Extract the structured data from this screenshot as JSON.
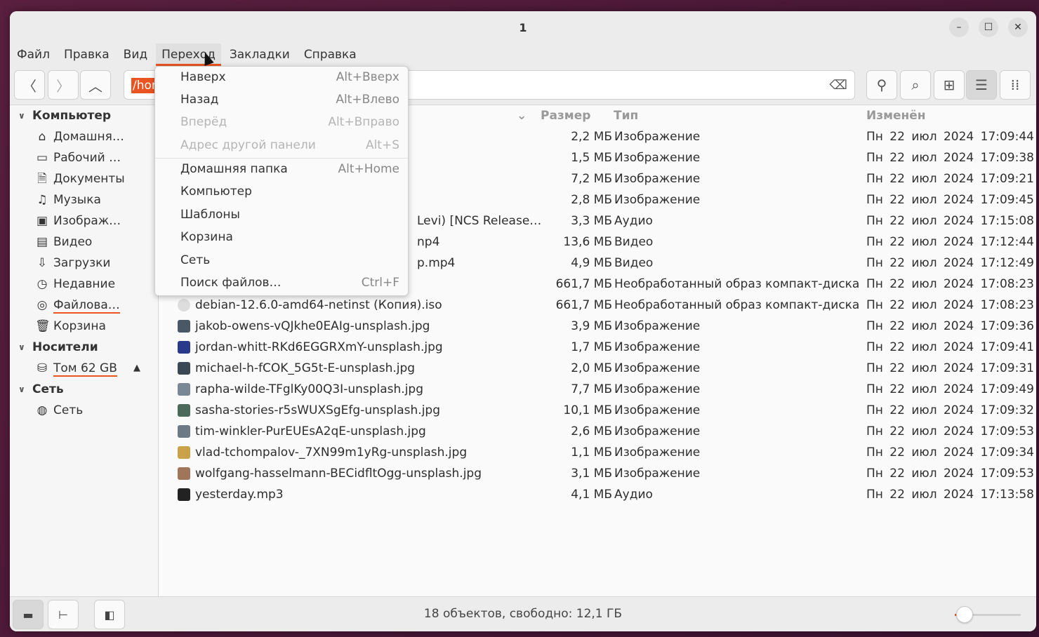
{
  "window": {
    "title": "1",
    "controls": {
      "minimize": "–",
      "maximize": "☐",
      "close": "✕"
    }
  },
  "menubar": [
    "Файл",
    "Правка",
    "Вид",
    "Переход",
    "Закладки",
    "Справка"
  ],
  "toolbar": {
    "path_selected": "/home",
    "icons": [
      "back-icon",
      "forward-icon",
      "up-icon",
      "location-icon",
      "search-icon",
      "grid-view-icon",
      "list-view-icon",
      "compact-view-icon"
    ]
  },
  "sidebar": {
    "computer_header": "Компьютер",
    "computer_items": [
      {
        "label": "Домашня…",
        "icon": "⌂"
      },
      {
        "label": "Рабочий …",
        "icon": "▭"
      },
      {
        "label": "Документы",
        "icon": "🗎"
      },
      {
        "label": "Музыка",
        "icon": "♫"
      },
      {
        "label": "Изображ…",
        "icon": "▣"
      },
      {
        "label": "Видео",
        "icon": "▤"
      },
      {
        "label": "Загрузки",
        "icon": "⇩"
      },
      {
        "label": "Недавние",
        "icon": "◷"
      },
      {
        "label": "Файлова…",
        "icon": "◎"
      },
      {
        "label": "Корзина",
        "icon": "🗑"
      }
    ],
    "devices_header": "Носители",
    "device_item": {
      "label": "Том 62 GB",
      "icon": "⛁",
      "eject": "▲"
    },
    "network_header": "Сеть",
    "network_item": {
      "label": "Сеть",
      "icon": "◍"
    }
  },
  "columns": {
    "size": "Размер",
    "type": "Тип",
    "modified": "Изменён"
  },
  "files": [
    {
      "name": "",
      "size": "2,2 МБ",
      "type": "Изображение",
      "date": "Пн 22 июл 2024 17:09:44"
    },
    {
      "name": "",
      "size": "1,5 МБ",
      "type": "Изображение",
      "date": "Пн 22 июл 2024 17:09:38"
    },
    {
      "name": "",
      "size": "7,2 МБ",
      "type": "Изображение",
      "date": "Пн 22 июл 2024 17:09:21"
    },
    {
      "name": "",
      "size": "2,8 МБ",
      "type": "Изображение",
      "date": "Пн 22 июл 2024 17:09:45"
    },
    {
      "name": "Levi) [NCS Release…",
      "size": "3,3 МБ",
      "type": "Аудио",
      "date": "Пн 22 июл 2024 17:15:08"
    },
    {
      "name": "np4",
      "size": "13,6 МБ",
      "type": "Видео",
      "date": "Пн 22 июл 2024 17:12:44"
    },
    {
      "name": "p.mp4",
      "size": "4,9 МБ",
      "type": "Видео",
      "date": "Пн 22 июл 2024 17:12:49"
    },
    {
      "name": "",
      "size": "661,7 МБ",
      "type": "Необработанный образ компакт-диска",
      "date": "Пн 22 июл 2024 17:08:23"
    },
    {
      "name": "debian-12.6.0-amd64-netinst (Копия).iso",
      "size": "661,7 МБ",
      "type": "Необработанный образ компакт-диска",
      "date": "Пн 22 июл 2024 17:08:23"
    },
    {
      "name": "jakob-owens-vQJkhe0EAIg-unsplash.jpg",
      "size": "3,9 МБ",
      "type": "Изображение",
      "date": "Пн 22 июл 2024 17:09:36"
    },
    {
      "name": "jordan-whitt-RKd6EGGRXmY-unsplash.jpg",
      "size": "1,7 МБ",
      "type": "Изображение",
      "date": "Пн 22 июл 2024 17:09:41"
    },
    {
      "name": "michael-h-fCOK_5G5t-E-unsplash.jpg",
      "size": "2,0 МБ",
      "type": "Изображение",
      "date": "Пн 22 июл 2024 17:09:31"
    },
    {
      "name": "rapha-wilde-TFglKy00Q3I-unsplash.jpg",
      "size": "7,7 МБ",
      "type": "Изображение",
      "date": "Пн 22 июл 2024 17:09:49"
    },
    {
      "name": "sasha-stories-r5sWUXSgEfg-unsplash.jpg",
      "size": "10,1 МБ",
      "type": "Изображение",
      "date": "Пн 22 июл 2024 17:09:32"
    },
    {
      "name": "tim-winkler-PurEUEsA2qE-unsplash.jpg",
      "size": "2,6 МБ",
      "type": "Изображение",
      "date": "Пн 22 июл 2024 17:09:53"
    },
    {
      "name": "vlad-tchompalov-_7XN99m1yRg-unsplash.jpg",
      "size": "1,1 МБ",
      "type": "Изображение",
      "date": "Пн 22 июл 2024 17:09:34"
    },
    {
      "name": "wolfgang-hasselmann-BECidfltOgg-unsplash.jpg",
      "size": "3,1 МБ",
      "type": "Изображение",
      "date": "Пн 22 июл 2024 17:09:53"
    },
    {
      "name": "yesterday.mp3",
      "size": "4,1 МБ",
      "type": "Аудио",
      "date": "Пн 22 июл 2024 17:13:58"
    }
  ],
  "go_menu": [
    {
      "label": "Наверх",
      "shortcut": "Alt+Вверх",
      "disabled": false
    },
    {
      "label": "Назад",
      "shortcut": "Alt+Влево",
      "disabled": false
    },
    {
      "label": "Вперёд",
      "shortcut": "Alt+Вправо",
      "disabled": true
    },
    {
      "label": "Адрес другой панели",
      "shortcut": "Alt+S",
      "disabled": true
    },
    {
      "label": "Домашняя папка",
      "shortcut": "Alt+Home",
      "disabled": false
    },
    {
      "label": "Компьютер",
      "shortcut": "",
      "disabled": false
    },
    {
      "label": "Шаблоны",
      "shortcut": "",
      "disabled": false
    },
    {
      "label": "Корзина",
      "shortcut": "",
      "disabled": false
    },
    {
      "label": "Сеть",
      "shortcut": "",
      "disabled": false
    },
    {
      "label": "Поиск файлов…",
      "shortcut": "Ctrl+F",
      "disabled": false
    }
  ],
  "status": {
    "text": "18 объектов, свободно: 12,1 ГБ",
    "zoom_level": 0.1
  },
  "colors": {
    "accent": "#e95420",
    "background": "#fafafa"
  }
}
